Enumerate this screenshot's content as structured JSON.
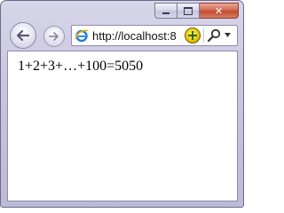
{
  "window": {
    "caption_buttons": {
      "minimize": "minimize",
      "maximize": "maximize",
      "close": "✕"
    }
  },
  "nav": {
    "back_icon": "back-arrow-icon",
    "forward_icon": "forward-arrow-icon"
  },
  "address_bar": {
    "url": "http://localhost:8",
    "page_icon": "ie-page-icon",
    "compat_icon": "compatibility-view-icon",
    "search_icon": "search-icon",
    "dropdown_icon": "chevron-down-icon"
  },
  "page": {
    "text": "1+2+3+…+100=5050"
  },
  "colors": {
    "frame": "#c9c6e0",
    "close": "#c24a30",
    "content_bg": "#ffffff"
  }
}
